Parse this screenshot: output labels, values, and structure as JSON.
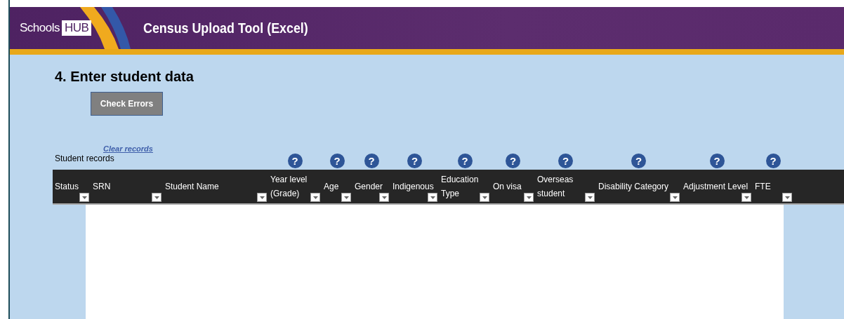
{
  "banner": {
    "brand": "Schools",
    "brand_badge": "HUB",
    "title": "Census Upload Tool (Excel)"
  },
  "section": {
    "heading": "4.  Enter student data",
    "check_button": "Check Errors",
    "clear_link": "Clear records",
    "table_caption": "Student records"
  },
  "columns": [
    {
      "lines": [
        "Status"
      ]
    },
    {
      "lines": [
        "SRN"
      ]
    },
    {
      "lines": [
        "Student Name"
      ]
    },
    {
      "lines": [
        "Year level",
        "(Grade)"
      ],
      "help_icon": "?"
    },
    {
      "lines": [
        "Age"
      ],
      "help_icon": "?"
    },
    {
      "lines": [
        "Gender"
      ],
      "help_icon": "?"
    },
    {
      "lines": [
        "Indigenous"
      ],
      "help_icon": "?"
    },
    {
      "lines": [
        "Education",
        "Type"
      ],
      "help_icon": "?"
    },
    {
      "lines": [
        "On visa"
      ],
      "help_icon": "?"
    },
    {
      "lines": [
        "Overseas",
        "student"
      ],
      "help_icon": "?"
    },
    {
      "lines": [
        "Disability Category"
      ],
      "help_icon": "?"
    },
    {
      "lines": [
        "Adjustment Level"
      ],
      "help_icon": "?"
    },
    {
      "lines": [
        "FTE"
      ],
      "help_icon": "?"
    }
  ]
}
